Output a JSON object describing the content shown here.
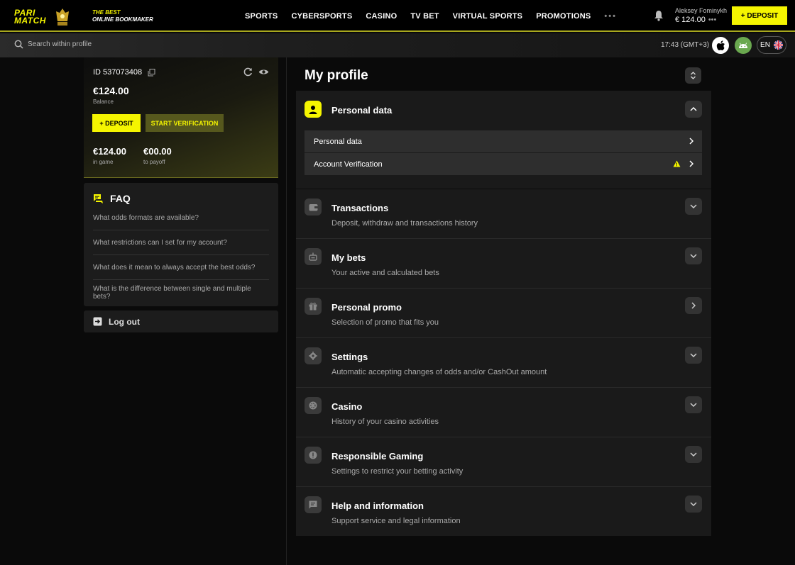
{
  "header": {
    "logo_word_top": "PARI",
    "logo_word_bottom": "MATCH",
    "tagline_line1": "THE BEST",
    "tagline_line2": "ONLINE BOOKMAKER",
    "nav": [
      "SPORTS",
      "CYBERSPORTS",
      "CASINO",
      "TV BET",
      "VIRTUAL SPORTS",
      "PROMOTIONS"
    ],
    "nav_more": "•••",
    "user_name": "Aleksey Fominykh",
    "user_balance": "€ 124.00",
    "user_balance_more": "•••",
    "deposit_label": "+ DEPOSIT"
  },
  "subheader": {
    "search_placeholder": "Search within profile",
    "time": "17:43 (GMT+3)",
    "language": "EN"
  },
  "balance_card": {
    "id": "ID 537073408",
    "balance": "€124.00",
    "balance_label": "Balance",
    "deposit_label": "+ DEPOSIT",
    "verify_label": "START VERIFICATION",
    "in_game_value": "€124.00",
    "in_game_label": "in game",
    "payoff_value": "€00.00",
    "payoff_label": "to payoff"
  },
  "faq": {
    "title": "FAQ",
    "items": [
      "What odds formats are available?",
      "What restrictions can I set for my account?",
      "What does it mean to always accept the best odds?",
      "What is the difference between single and multiple bets?"
    ]
  },
  "logout_label": "Log out",
  "main": {
    "title": "My profile",
    "personal": {
      "title": "Personal data",
      "rows": [
        "Personal data",
        "Account Verification"
      ]
    },
    "sections": [
      {
        "title": "Transactions",
        "subtitle": "Deposit, withdraw and transactions history",
        "icon": "wallet-icon"
      },
      {
        "title": "My bets",
        "subtitle": "Your active and calculated bets",
        "icon": "bets-icon"
      },
      {
        "title": "Personal promo",
        "subtitle": "Selection of promo that fits you",
        "icon": "gift-icon"
      },
      {
        "title": "Settings",
        "subtitle": "Automatic accepting changes of odds and/or CashOut amount",
        "icon": "gear-icon"
      },
      {
        "title": "Casino",
        "subtitle": "History of your casino activities",
        "icon": "casino-chip-icon"
      },
      {
        "title": "Responsible Gaming",
        "subtitle": "Settings to restrict your betting activity",
        "icon": "info-icon"
      },
      {
        "title": "Help and information",
        "subtitle": "Support service and legal information",
        "icon": "help-icon"
      }
    ]
  },
  "colors": {
    "accent": "#f5f500",
    "background": "#0a0a0a",
    "panel": "#1a1a1a"
  }
}
